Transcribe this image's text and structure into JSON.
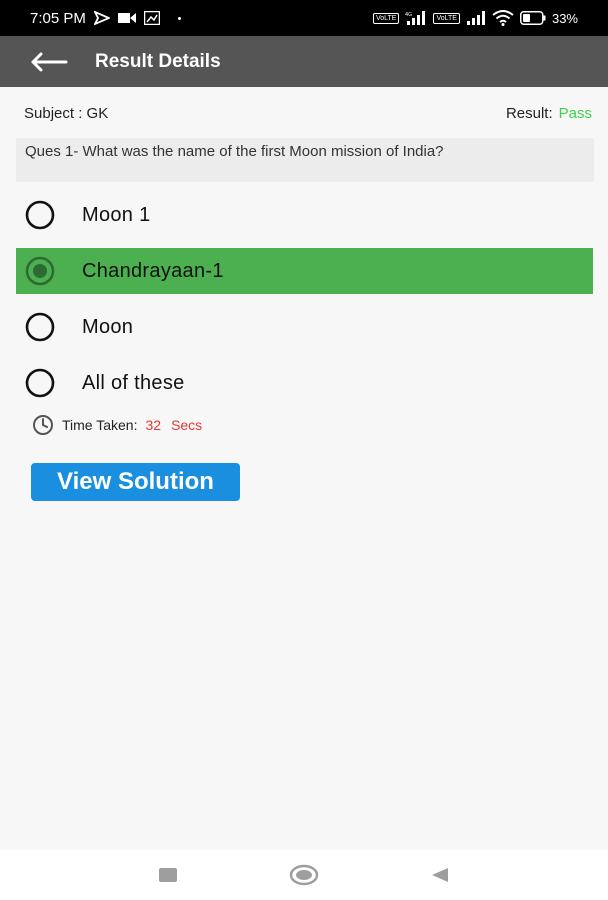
{
  "status_bar": {
    "time": "7:05 PM",
    "sim1_label": "VoLTE",
    "sim2_label": "VoLTE",
    "network_label": "4G",
    "battery": "33%"
  },
  "app_bar": {
    "title": "Result Details",
    "back_icon": "arrow-left-icon"
  },
  "meta": {
    "subject_label": "Subject : GK",
    "result_label": "Result:",
    "result_value": "Pass",
    "result_color": "#3fd24a"
  },
  "question": {
    "text": "Ques  1- What was the name of the first Moon mission of India?"
  },
  "options": [
    {
      "label": "Moon 1",
      "selected": false
    },
    {
      "label": "Chandrayaan-1",
      "selected": true
    },
    {
      "label": "Moon",
      "selected": false
    },
    {
      "label": "All of these",
      "selected": false
    }
  ],
  "selected_color": "#4caf50",
  "time": {
    "label": "Time Taken:",
    "value": "32",
    "unit": "Secs"
  },
  "actions": {
    "view_solution": "View Solution"
  },
  "nav": {
    "recents_icon": "square-icon",
    "home_icon": "circle-icon",
    "back_icon": "triangle-back-icon"
  }
}
